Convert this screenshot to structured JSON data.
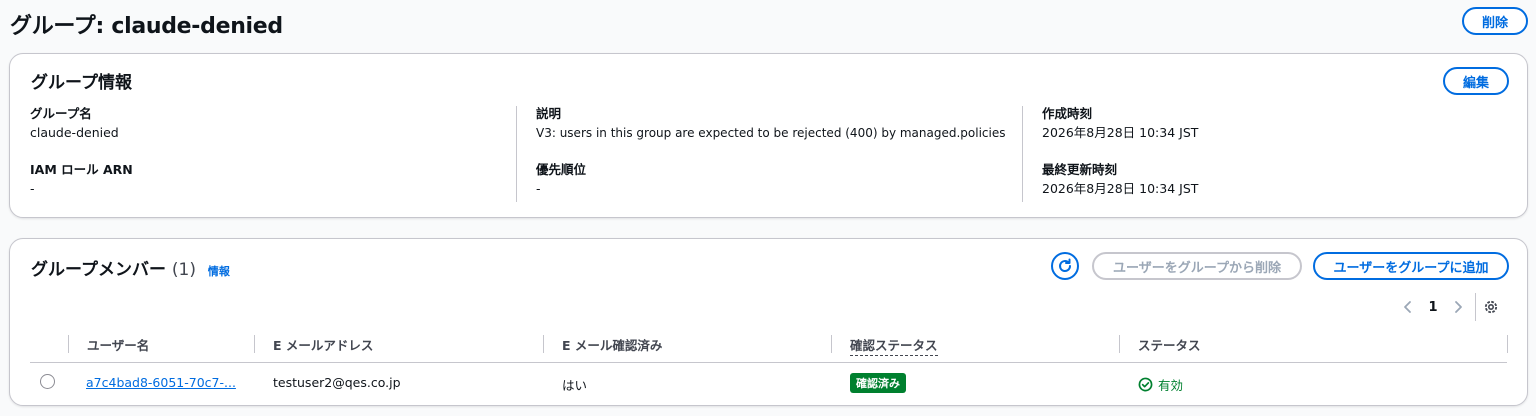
{
  "header": {
    "title": "グループ: claude-denied",
    "delete_label": "削除"
  },
  "group_info": {
    "title": "グループ情報",
    "edit_label": "編集",
    "fields": {
      "name_label": "グループ名",
      "name_value": "claude-denied",
      "iam_label": "IAM ロール ARN",
      "iam_value": "-",
      "desc_label": "説明",
      "desc_value": "V3: users in this group are expected to be rejected (400) by managed.policies",
      "priority_label": "優先順位",
      "priority_value": "-",
      "created_label": "作成時刻",
      "created_value": "2026年8月28日 10:34 JST",
      "updated_label": "最終更新時刻",
      "updated_value": "2026年8月28日 10:34 JST"
    }
  },
  "members": {
    "title": "グループメンバー",
    "count": "(1)",
    "info_label": "情報",
    "remove_label": "ユーザーをグループから削除",
    "add_label": "ユーザーをグループに追加",
    "page_number": "1",
    "columns": [
      "ユーザー名",
      "E メールアドレス",
      "E メール確認済み",
      "確認ステータス",
      "ステータス"
    ],
    "rows": [
      {
        "username": "a7c4bad8-6051-70c7-...",
        "email": "testuser2@qes.co.jp",
        "email_verified": "はい",
        "confirmation_status": "確認済み",
        "status": "有効"
      }
    ]
  },
  "colors": {
    "accent": "#006ce0",
    "success": "#00802f",
    "border": "#c6c6cd"
  },
  "icons": [
    "refresh-icon",
    "chevron-left-icon",
    "chevron-right-icon",
    "gear-icon",
    "check-circle-icon"
  ]
}
